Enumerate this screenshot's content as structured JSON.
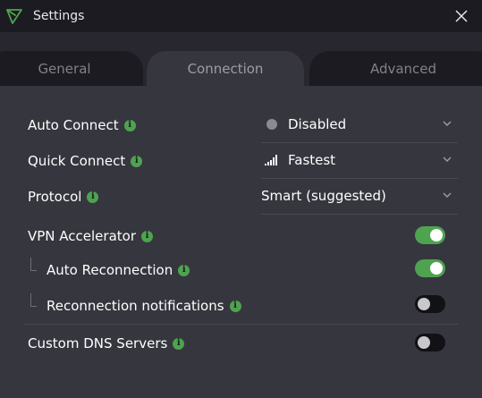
{
  "window": {
    "title": "Settings"
  },
  "tabs": [
    {
      "label": "General"
    },
    {
      "label": "Connection"
    },
    {
      "label": "Advanced"
    }
  ],
  "active_tab": "Connection",
  "settings": {
    "auto_connect": {
      "label": "Auto Connect",
      "value": "Disabled"
    },
    "quick_connect": {
      "label": "Quick Connect",
      "value": "Fastest"
    },
    "protocol": {
      "label": "Protocol",
      "value": "Smart (suggested)"
    },
    "vpn_accelerator": {
      "label": "VPN Accelerator",
      "enabled": true
    },
    "auto_reconnection": {
      "label": "Auto Reconnection",
      "enabled": true
    },
    "reconnection_notifications": {
      "label": "Reconnection notifications",
      "enabled": false
    },
    "custom_dns": {
      "label": "Custom DNS Servers",
      "enabled": false
    }
  },
  "info_glyph": "i",
  "colors": {
    "accent": "#4ea34f",
    "background": "#1c1b22",
    "panel": "#36363f",
    "tab_band": "#28272f",
    "toggle_off": "#111116"
  },
  "icons": {
    "app": "vpn-triangle-logo-icon",
    "close": "close-icon",
    "info": "info-icon",
    "chevron": "chevron-down-icon",
    "status_dot": "status-dot-icon",
    "signal": "signal-bars-icon"
  }
}
